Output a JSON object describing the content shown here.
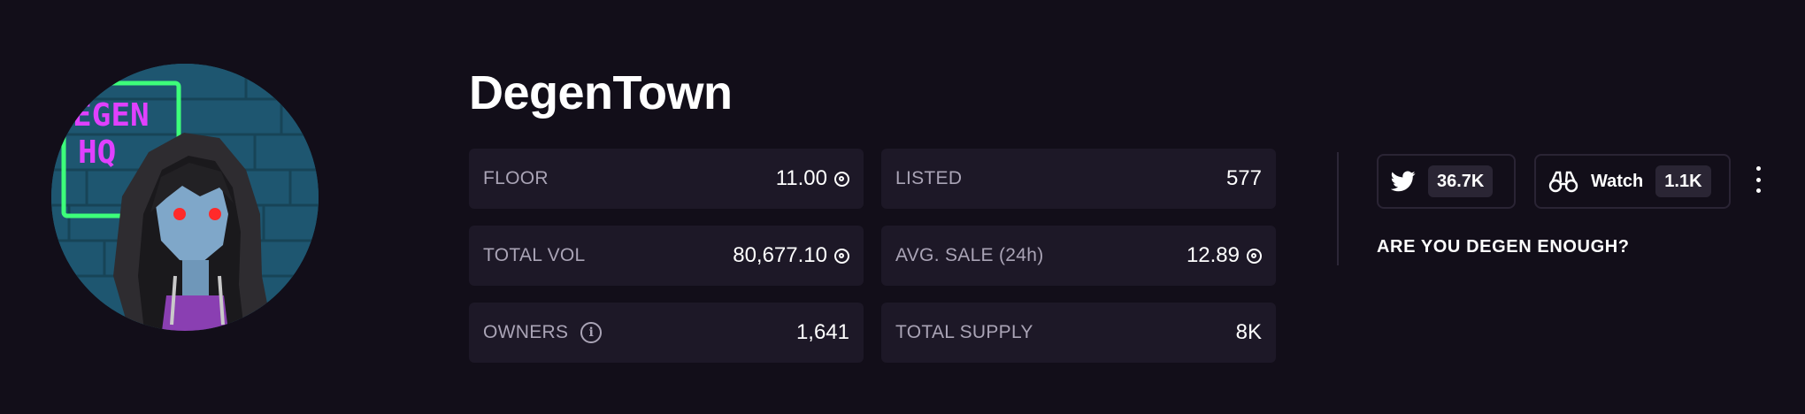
{
  "collection": {
    "name": "DegenTown",
    "avatar_alt": "pixel-art hooded character avatar",
    "avatar_sign_lines": [
      "EGEN",
      "HQ"
    ]
  },
  "stats": {
    "floor": {
      "label": "FLOOR",
      "value": "11.00"
    },
    "listed": {
      "label": "LISTED",
      "value": "577"
    },
    "total_vol": {
      "label": "TOTAL VOL",
      "value": "80,677.10"
    },
    "avg_sale": {
      "label": "AVG. SALE (24h)",
      "value": "12.89"
    },
    "owners": {
      "label": "OWNERS",
      "value": "1,641",
      "info_glyph": "i"
    },
    "total_supply": {
      "label": "TOTAL SUPPLY",
      "value": "8K"
    }
  },
  "social": {
    "twitter": {
      "icon": "twitter-bird-icon",
      "count": "36.7K"
    },
    "watch": {
      "icon": "binoculars-icon",
      "label": "Watch",
      "count": "1.1K"
    },
    "more_icon": "vertical-ellipsis-icon"
  },
  "tagline": "ARE YOU DEGEN ENOUGH?",
  "colors": {
    "background": "#120e19",
    "card": "#1d1827",
    "label": "#aaa4b6",
    "neon_pink": "#e040ff",
    "neon_green": "#3dff7a"
  }
}
